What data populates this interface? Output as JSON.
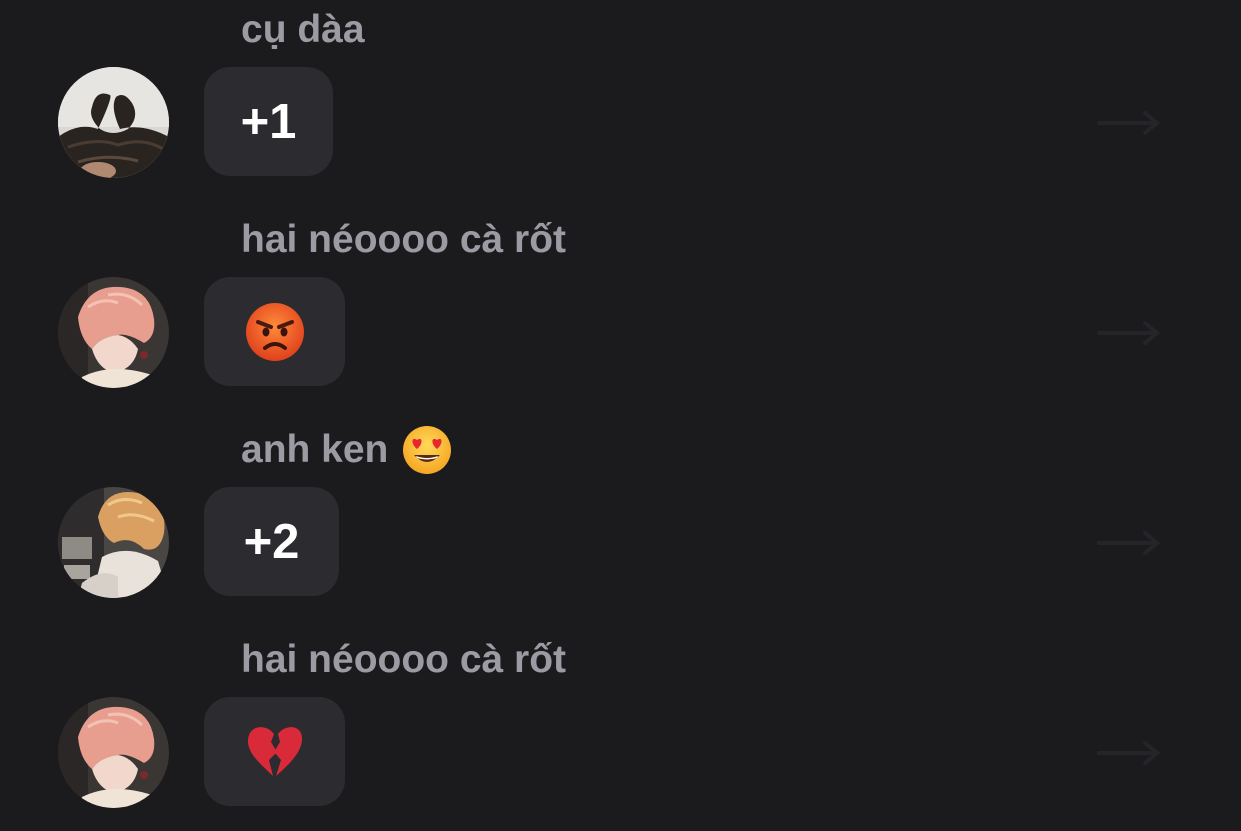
{
  "messages": [
    {
      "sender": "cụ dàa",
      "sender_emoji": "",
      "avatar": "heart-hair-avatar",
      "content": "+1",
      "content_type": "text"
    },
    {
      "sender": "hai néoooo cà rốt",
      "sender_emoji": "",
      "avatar": "pink-hair-avatar",
      "content": "",
      "content_type": "emoji",
      "emoji": "angry-face"
    },
    {
      "sender": "anh ken",
      "sender_emoji": "heart-eyes-face",
      "avatar": "curly-hair-avatar",
      "content": "+2",
      "content_type": "text"
    },
    {
      "sender": "hai néoooo cà rốt",
      "sender_emoji": "",
      "avatar": "pink-hair-avatar",
      "content": "",
      "content_type": "emoji",
      "emoji": "broken-heart"
    }
  ],
  "colors": {
    "background": "#1b1a1d",
    "bubble": "#2c2b2f",
    "sender_name": "#9c9aa2",
    "message_text": "#ffffff"
  }
}
